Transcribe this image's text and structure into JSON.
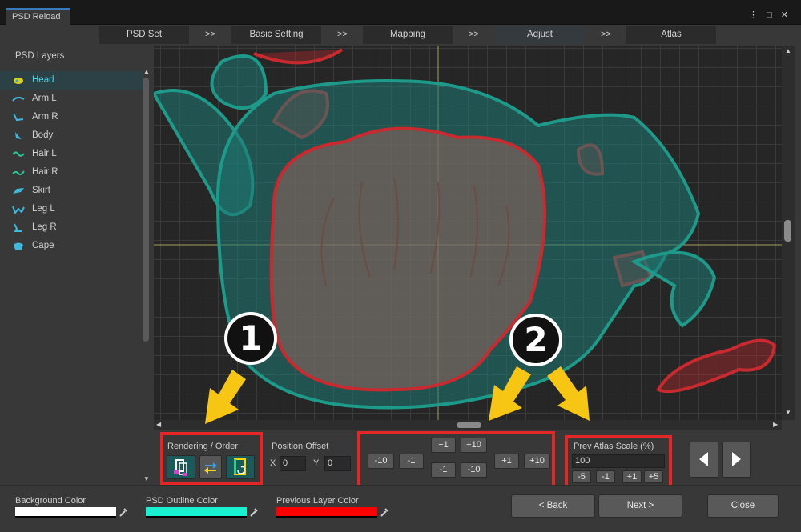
{
  "window": {
    "tab_title": "PSD Reload",
    "controls": "⋮ □ ✕"
  },
  "steps": [
    {
      "label": "PSD Set"
    },
    {
      "label": "Basic Setting"
    },
    {
      "label": "Mapping"
    },
    {
      "label": "Adjust"
    },
    {
      "label": "Atlas"
    }
  ],
  "step_sep": ">>",
  "layers": {
    "title": "PSD Layers",
    "items": [
      {
        "label": "Head",
        "icon": "head-icon"
      },
      {
        "label": "Arm L",
        "icon": "arm-l-icon"
      },
      {
        "label": "Arm R",
        "icon": "arm-r-icon"
      },
      {
        "label": "Body",
        "icon": "body-icon"
      },
      {
        "label": "Hair L",
        "icon": "hair-l-icon"
      },
      {
        "label": "Hair R",
        "icon": "hair-r-icon"
      },
      {
        "label": "Skirt",
        "icon": "skirt-icon"
      },
      {
        "label": "Leg L",
        "icon": "leg-l-icon"
      },
      {
        "label": "Leg R",
        "icon": "leg-r-icon"
      },
      {
        "label": "Cape",
        "icon": "cape-icon"
      }
    ]
  },
  "controls": {
    "rendering_label": "Rendering / Order",
    "position_label": "Position Offset",
    "x_label": "X",
    "y_label": "Y",
    "x_value": "0",
    "y_value": "0",
    "offset_buttons": {
      "up1": "+1",
      "up10": "+10",
      "left10": "-10",
      "left1": "-1",
      "down1": "-1",
      "down10": "-10",
      "right1": "+1",
      "right10": "+10"
    },
    "scale_label": "Prev Atlas Scale (%)",
    "scale_value": "100",
    "scale_buttons": {
      "m5": "-5",
      "m1": "-1",
      "p1": "+1",
      "p5": "+5"
    }
  },
  "bottom": {
    "bg_color_label": "Background Color",
    "outline_color_label": "PSD Outline Color",
    "prev_color_label": "Previous Layer Color",
    "back_label": "< Back",
    "next_label": "Next >",
    "close_label": "Close"
  },
  "colors": {
    "background": "#ffffff",
    "outline": "#19f0d2",
    "previous": "#ff0000",
    "accent_red": "#e42626"
  },
  "callouts": {
    "one": "1",
    "two": "2"
  }
}
